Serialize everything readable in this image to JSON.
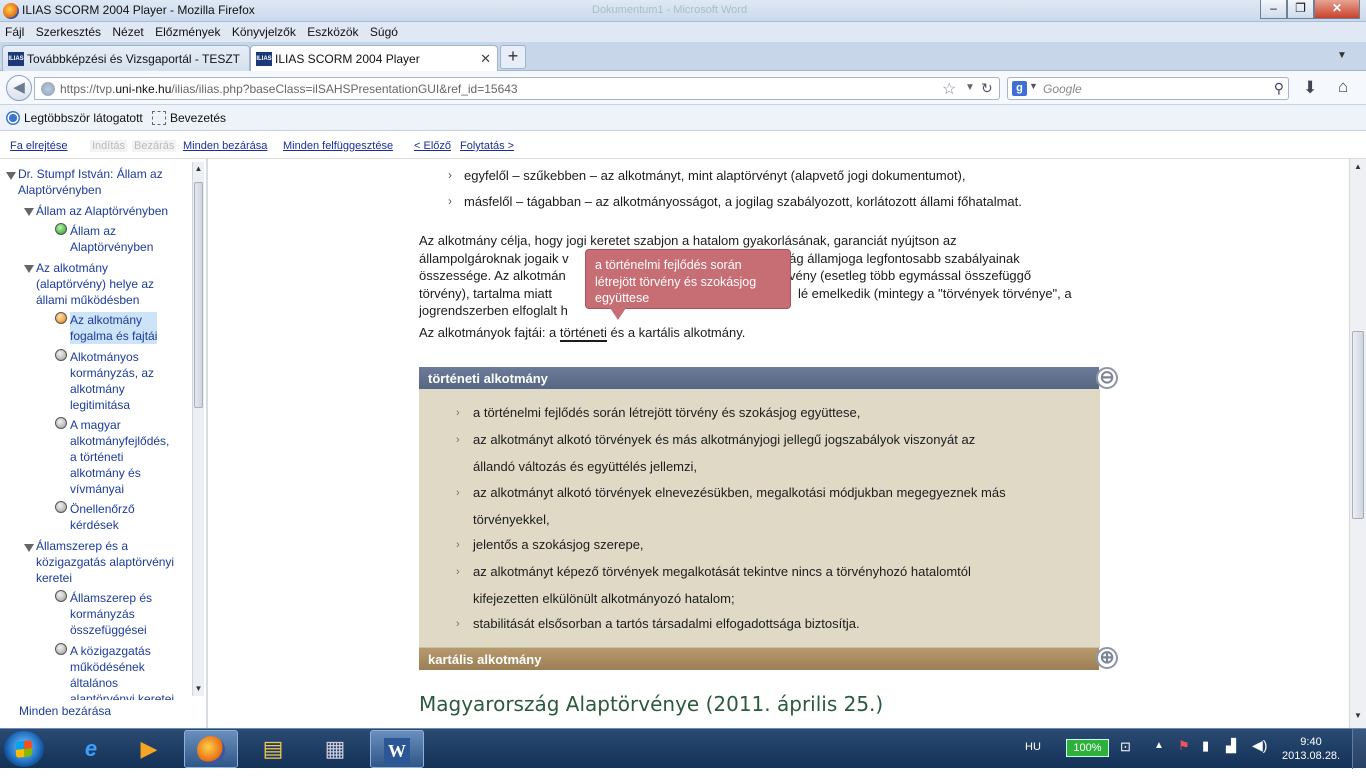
{
  "window": {
    "title": "ILIAS SCORM 2004 Player - Mozilla Firefox",
    "background_title": "Dokumentum1 - Microsoft Word",
    "min": "–",
    "max": "❐",
    "close": "✕"
  },
  "menu": [
    "Fájl",
    "Szerkesztés",
    "Nézet",
    "Előzmények",
    "Könyvjelzők",
    "Eszközök",
    "Súgó"
  ],
  "tabs": [
    {
      "label": "Továbbképzési és Vizsgaportál - TESZT",
      "favicon": "ILIAS"
    },
    {
      "label": "ILIAS SCORM 2004 Player",
      "favicon": "ILIAS"
    }
  ],
  "newtab": "+",
  "url": {
    "prefix": "https://tvp.",
    "host": "uni-nke.hu",
    "path": "/ilias/ilias.php?baseClass=ilSAHSPresentationGUI&ref_id=15643"
  },
  "search_placeholder": "Google",
  "bookmarks": [
    "Legtöbbször látogatott",
    "Bevezetés"
  ],
  "controls": {
    "hide_tree": "Fa elrejtése",
    "start": "Indítás",
    "close": "Bezárás",
    "close_all": "Minden bezárása",
    "suspend_all": "Minden felfüggesztése",
    "prev": "< Előző",
    "continue": "Folytatás >"
  },
  "tree": {
    "root": [
      "Dr. Stumpf István: Állam az",
      "Alaptörvényben"
    ],
    "ch1": "Állam az Alaptörvényben",
    "ch1_item1": [
      "Állam az",
      "Alaptörvényben"
    ],
    "ch2": [
      "Az alkotmány",
      "(alaptörvény) helye az",
      "állami működésben"
    ],
    "ch2_item1": [
      "Az alkotmány",
      "fogalma és fajtái"
    ],
    "ch2_item2": [
      "Alkotmányos",
      "kormányzás, az",
      "alkotmány",
      "legitimitása"
    ],
    "ch2_item3": [
      "A magyar",
      "alkotmányfejlődés,",
      "a történeti",
      "alkotmány és",
      "vívmányai"
    ],
    "ch2_item4": [
      "Önellenőrző",
      "kérdések"
    ],
    "ch3": [
      "Államszerep és a",
      "közigazgatás alaptörvényi",
      "keretei"
    ],
    "ch3_item1": [
      "Államszerep és",
      "kormányzás",
      "összefüggései"
    ],
    "ch3_item2": [
      "A közigazgatás",
      "működésének",
      "általános",
      "alaptörvényi keretei"
    ],
    "footer": "Minden bezárása"
  },
  "content": {
    "bullets": [
      "egyfelől – szűkebben – az alkotmányt, mint alaptörvényt (alapvető jogi dokumentumot),",
      "másfelől – tágabban – az alkotmányosságot, a jogilag szabályozott, korlátozott állami főhatalmat."
    ],
    "para_lines": [
      "Az alkotmány célja, hogy jogi keretet szabjon a hatalom gyakorlásának, garanciát nyújtson az",
      "állampolgároknak jogaik v",
      "ország államjoga legfontosabb szabályainak",
      "összessége. Az alkotmán",
      "rvény (esetleg több egymással összefüggő",
      "törvény), tartalma miatt",
      "lé emelkedik (mintegy a \"törvények törvénye\", a",
      "jogrendszerben elfoglalt h"
    ],
    "types_prefix": "Az alkotmányok fajtái: a ",
    "types_term": "történeti",
    "types_suffix": " és a kartális alkotmány.",
    "tooltip": "a történelmi fejlődés során létrejött törvény és szokásjog együttese",
    "acc1_title": "történeti alkotmány",
    "acc1_icon": "⊖",
    "acc1_items": [
      [
        "a történelmi fejlődés során létrejött törvény és szokásjog együttese,"
      ],
      [
        "az alkotmányt alkotó törvények és más alkotmányjogi jellegű jogszabályok viszonyát az",
        "állandó változás és együttélés jellemzi,"
      ],
      [
        "az alkotmányt alkotó törvények elnevezésükben, megalkotási módjukban megegyeznek más",
        "törvényekkel,"
      ],
      [
        "jelentős a szokásjog szerepe,"
      ],
      [
        "az alkotmányt képező törvények megalkotását tekintve nincs a törvényhozó hatalomtól",
        "kifejezetten elkülönült alkotmányozó hatalom;"
      ],
      [
        "stabilitását elsősorban a tartós társadalmi elfogadottsága biztosítja."
      ]
    ],
    "acc2_title": "kartális alkotmány",
    "acc2_icon": "⊕",
    "heading": "Magyarország Alaptörvénye (2011. április 25.)"
  },
  "taskbar": {
    "lang": "HU",
    "battery": "100%",
    "time": "9:40",
    "date": "2013.08.28."
  }
}
